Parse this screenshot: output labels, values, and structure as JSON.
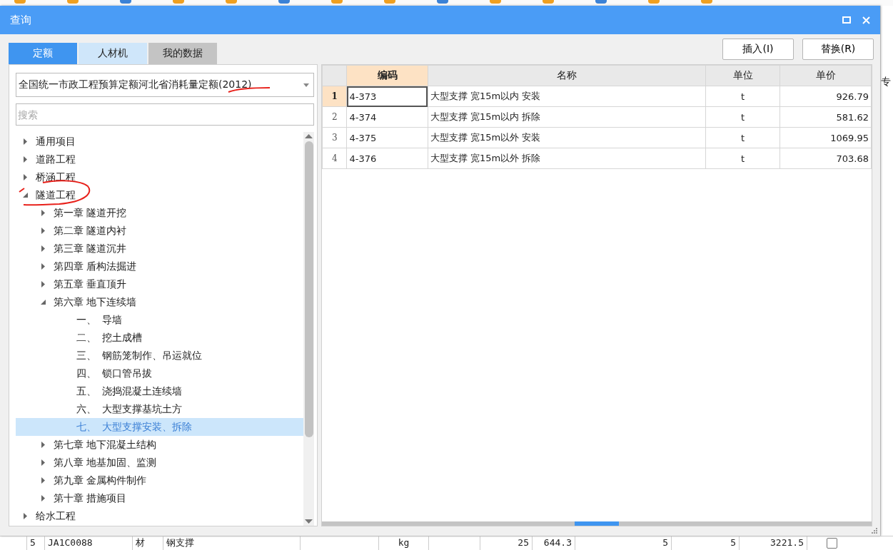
{
  "window": {
    "title": "查询"
  },
  "tabs": [
    {
      "label": "定额",
      "selected": true
    },
    {
      "label": "人材机",
      "selected": false
    },
    {
      "label": "我的数据",
      "selected": false
    }
  ],
  "buttons": [
    "插入(I)",
    "替换(R)"
  ],
  "library": {
    "value": "全国统一市政工程预算定额河北省消耗量定额(2012)"
  },
  "search": {
    "placeholder": "搜索"
  },
  "tree": [
    {
      "label": "通用项目",
      "expanded": false,
      "selected": false
    },
    {
      "label": "道路工程",
      "expanded": false,
      "selected": false
    },
    {
      "label": "桥涵工程",
      "expanded": false,
      "selected": false
    },
    {
      "label": "隧道工程",
      "expanded": true,
      "selected": false,
      "children": [
        {
          "label": "第一章 隧道开挖",
          "expanded": false,
          "selected": false
        },
        {
          "label": "第二章 隧道内衬",
          "expanded": false,
          "selected": false
        },
        {
          "label": "第三章 隧道沉井",
          "expanded": false,
          "selected": false
        },
        {
          "label": "第四章 盾构法掘进",
          "expanded": false,
          "selected": false
        },
        {
          "label": "第五章 垂直顶升",
          "expanded": false,
          "selected": false
        },
        {
          "label": "第六章 地下连续墙",
          "expanded": true,
          "selected": false,
          "children": [
            {
              "number": "一、",
              "label": "导墙",
              "selected": false
            },
            {
              "number": "二、",
              "label": "挖土成槽",
              "selected": false
            },
            {
              "number": "三、",
              "label": "钢筋笼制作、吊运就位",
              "selected": false
            },
            {
              "number": "四、",
              "label": "锁口管吊拔",
              "selected": false
            },
            {
              "number": "五、",
              "label": "浇捣混凝土连续墙",
              "selected": false
            },
            {
              "number": "六、",
              "label": "大型支撑基坑土方",
              "selected": false
            },
            {
              "number": "七、",
              "label": "大型支撑安装、拆除",
              "selected": true
            }
          ]
        },
        {
          "label": "第七章 地下混凝土结构",
          "expanded": false,
          "selected": false
        },
        {
          "label": "第八章 地基加固、监测",
          "expanded": false,
          "selected": false
        },
        {
          "label": "第九章 金属构件制作",
          "expanded": false,
          "selected": false
        },
        {
          "label": "第十章 措施项目",
          "expanded": false,
          "selected": false
        }
      ]
    },
    {
      "label": "给水工程",
      "expanded": false,
      "selected": false
    }
  ],
  "table": {
    "columns": [
      "编码",
      "名称",
      "单位",
      "单价"
    ],
    "rows": [
      {
        "index": "1",
        "code": "4-373",
        "name": "大型支撑 宽15m以内 安装",
        "unit": "t",
        "price": "926.79",
        "selected": true
      },
      {
        "index": "2",
        "code": "4-374",
        "name": "大型支撑 宽15m以内 拆除",
        "unit": "t",
        "price": "581.62",
        "selected": false
      },
      {
        "index": "3",
        "code": "4-375",
        "name": "大型支撑 宽15m以外 安装",
        "unit": "t",
        "price": "1069.95",
        "selected": false
      },
      {
        "index": "4",
        "code": "4-376",
        "name": "大型支撑 宽15m以外 拆除",
        "unit": "t",
        "price": "703.68",
        "selected": false
      }
    ]
  },
  "side_panel": {
    "header": "专"
  },
  "background_row": {
    "cells": [
      "5",
      "JA1C0088",
      "材",
      "钢支撑",
      "",
      "kg",
      "",
      "25",
      "644.3",
      "5",
      "5",
      "3221.5"
    ],
    "checked": false
  }
}
